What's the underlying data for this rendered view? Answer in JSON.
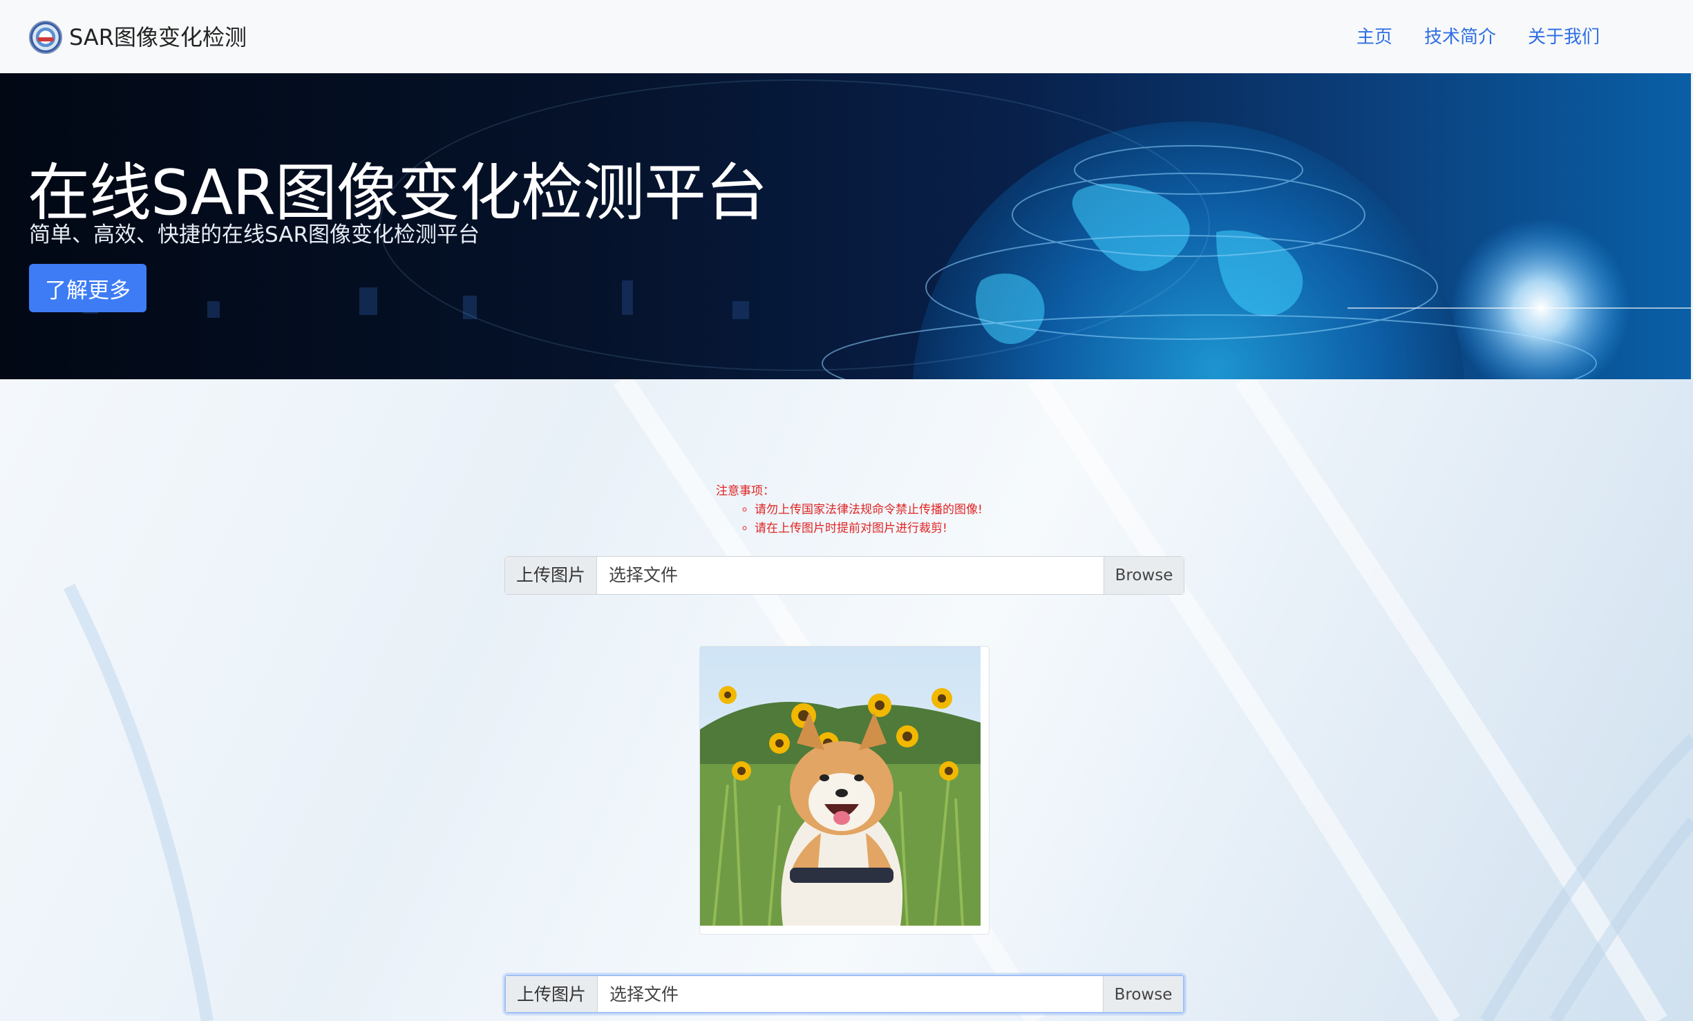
{
  "navbar": {
    "brand": "SAR图像变化检测",
    "links": [
      "主页",
      "技术简介",
      "关于我们"
    ],
    "link_color": "#2f6fe4"
  },
  "hero": {
    "title": "在线SAR图像变化检测平台",
    "subtitle": "简单、高效、快捷的在线SAR图像变化检测平台",
    "button": "了解更多",
    "button_color": "#3d7cf5"
  },
  "notice": {
    "heading": "注意事项：",
    "items": [
      "请勿上传国家法律法规命令禁止传播的图像!",
      "请在上传图片时提前对图片进行裁剪!"
    ],
    "color": "#e02424"
  },
  "upload1": {
    "label": "上传图片",
    "placeholder": "选择文件",
    "browse": "Browse"
  },
  "upload2": {
    "label": "上传图片",
    "placeholder": "选择文件",
    "browse": "Browse"
  },
  "preview": {
    "icon": "shiba-dog-sunflowers-photo"
  }
}
